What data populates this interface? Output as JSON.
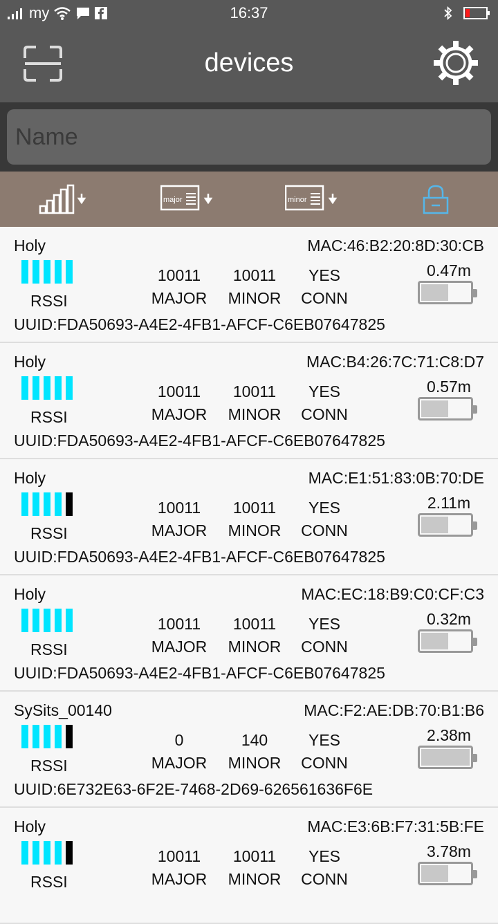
{
  "statusbar": {
    "carrier": "my",
    "time": "16:37"
  },
  "appbar": {
    "title": "devices"
  },
  "search": {
    "placeholder": "Name"
  },
  "sortbar": {
    "major_label": "major",
    "minor_label": "minor"
  },
  "labels": {
    "rssi": "RSSI",
    "major": "MAJOR",
    "minor": "MINOR",
    "conn": "CONN"
  },
  "colors": {
    "signal_on": "#00e5ff",
    "signal_off": "#000000",
    "appbar": "#585858",
    "sortbar": "#8c7b70"
  },
  "devices": [
    {
      "name": "Holy",
      "mac": "MAC:46:B2:20:8D:30:CB",
      "signal_bars": 5,
      "major": "10011",
      "minor": "10011",
      "conn": "YES",
      "distance": "0.47m",
      "battery_level": 0.55,
      "uuid": "UUID:FDA50693-A4E2-4FB1-AFCF-C6EB07647825"
    },
    {
      "name": "Holy",
      "mac": "MAC:B4:26:7C:71:C8:D7",
      "signal_bars": 5,
      "major": "10011",
      "minor": "10011",
      "conn": "YES",
      "distance": "0.57m",
      "battery_level": 0.55,
      "uuid": "UUID:FDA50693-A4E2-4FB1-AFCF-C6EB07647825"
    },
    {
      "name": "Holy",
      "mac": "MAC:E1:51:83:0B:70:DE",
      "signal_bars": 4,
      "major": "10011",
      "minor": "10011",
      "conn": "YES",
      "distance": "2.11m",
      "battery_level": 0.55,
      "uuid": "UUID:FDA50693-A4E2-4FB1-AFCF-C6EB07647825"
    },
    {
      "name": "Holy",
      "mac": "MAC:EC:18:B9:C0:CF:C3",
      "signal_bars": 5,
      "major": "10011",
      "minor": "10011",
      "conn": "YES",
      "distance": "0.32m",
      "battery_level": 0.55,
      "uuid": "UUID:FDA50693-A4E2-4FB1-AFCF-C6EB07647825"
    },
    {
      "name": "SySits_00140",
      "mac": "MAC:F2:AE:DB:70:B1:B6",
      "signal_bars": 4,
      "major": "0",
      "minor": "140",
      "conn": "YES",
      "distance": "2.38m",
      "battery_level": 1.0,
      "uuid": "UUID:6E732E63-6F2E-7468-2D69-626561636F6E"
    },
    {
      "name": "Holy",
      "mac": "MAC:E3:6B:F7:31:5B:FE",
      "signal_bars": 4,
      "major": "10011",
      "minor": "10011",
      "conn": "YES",
      "distance": "3.78m",
      "battery_level": 0.55,
      "uuid": ""
    }
  ]
}
